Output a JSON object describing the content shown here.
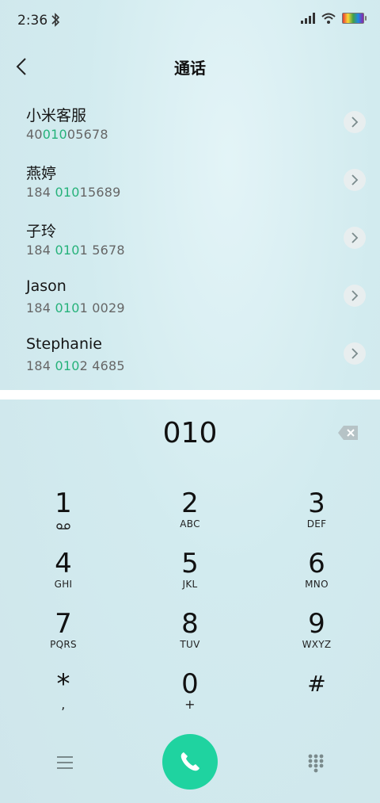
{
  "status": {
    "time": "2:36"
  },
  "header": {
    "title": "通话"
  },
  "contacts": [
    {
      "name": "小米客服",
      "num_pre": "40",
      "num_hl": "010",
      "num_post": "05678"
    },
    {
      "name": "燕婷",
      "num_pre": "184 ",
      "num_hl": "010",
      "num_post": "15689"
    },
    {
      "name": "子玲",
      "num_pre": "184 ",
      "num_hl": "010",
      "num_post": "1 5678"
    },
    {
      "name": "Jason",
      "num_pre": "184 ",
      "num_hl": "010",
      "num_post": "1 0029"
    },
    {
      "name": "Stephanie",
      "num_pre": "184 ",
      "num_hl": "010",
      "num_post": "2 4685"
    }
  ],
  "dialer": {
    "number": "010",
    "keys": [
      {
        "digit": "1",
        "letters": ""
      },
      {
        "digit": "2",
        "letters": "ABC"
      },
      {
        "digit": "3",
        "letters": "DEF"
      },
      {
        "digit": "4",
        "letters": "GHI"
      },
      {
        "digit": "5",
        "letters": "JKL"
      },
      {
        "digit": "6",
        "letters": "MNO"
      },
      {
        "digit": "7",
        "letters": "PQRS"
      },
      {
        "digit": "8",
        "letters": "TUV"
      },
      {
        "digit": "9",
        "letters": "WXYZ"
      },
      {
        "digit": "*",
        "letters": ","
      },
      {
        "digit": "0",
        "letters": "+"
      },
      {
        "digit": "#",
        "letters": ""
      }
    ]
  },
  "colors": {
    "highlight": "#26b27a",
    "call_button": "#1fd3a0"
  }
}
